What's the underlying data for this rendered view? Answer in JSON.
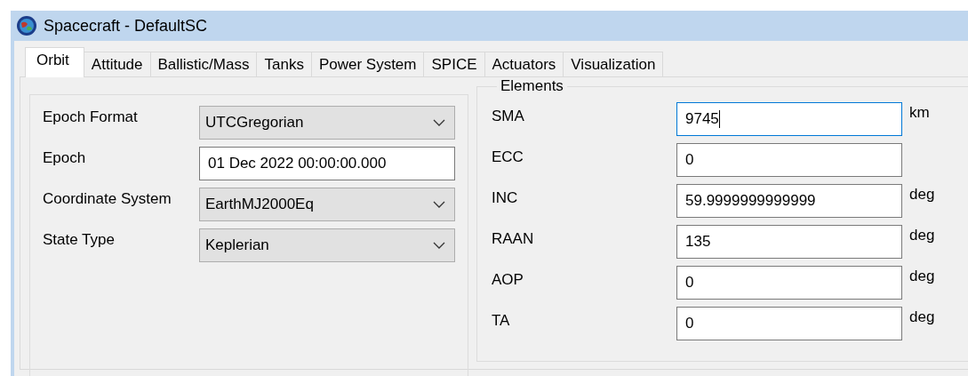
{
  "window": {
    "title": "Spacecraft - DefaultSC"
  },
  "tabs": [
    {
      "label": "Orbit",
      "selected": true
    },
    {
      "label": "Attitude",
      "selected": false
    },
    {
      "label": "Ballistic/Mass",
      "selected": false
    },
    {
      "label": "Tanks",
      "selected": false
    },
    {
      "label": "Power System",
      "selected": false
    },
    {
      "label": "SPICE",
      "selected": false
    },
    {
      "label": "Actuators",
      "selected": false
    },
    {
      "label": "Visualization",
      "selected": false
    }
  ],
  "epoch_panel": {
    "fields": [
      {
        "label": "Epoch Format",
        "kind": "dropdown",
        "value": "UTCGregorian"
      },
      {
        "label": "Epoch",
        "kind": "text",
        "value": "01 Dec 2022 00:00:00.000"
      },
      {
        "label": "Coordinate System",
        "kind": "dropdown",
        "value": "EarthMJ2000Eq"
      },
      {
        "label": "State Type",
        "kind": "dropdown",
        "value": "Keplerian"
      }
    ]
  },
  "elements": {
    "title": "Elements",
    "fields": [
      {
        "label": "SMA",
        "value": "9745",
        "unit": "km",
        "focused": true
      },
      {
        "label": "ECC",
        "value": "0",
        "focused": false
      },
      {
        "label": "INC",
        "value": "59.9999999999999",
        "unit": "deg",
        "focused": false
      },
      {
        "label": "RAAN",
        "value": "135",
        "unit": "deg",
        "focused": false
      },
      {
        "label": "AOP",
        "value": "0",
        "unit": "deg",
        "focused": false
      },
      {
        "label": "TA",
        "value": "0",
        "unit": "deg",
        "focused": false
      }
    ]
  }
}
